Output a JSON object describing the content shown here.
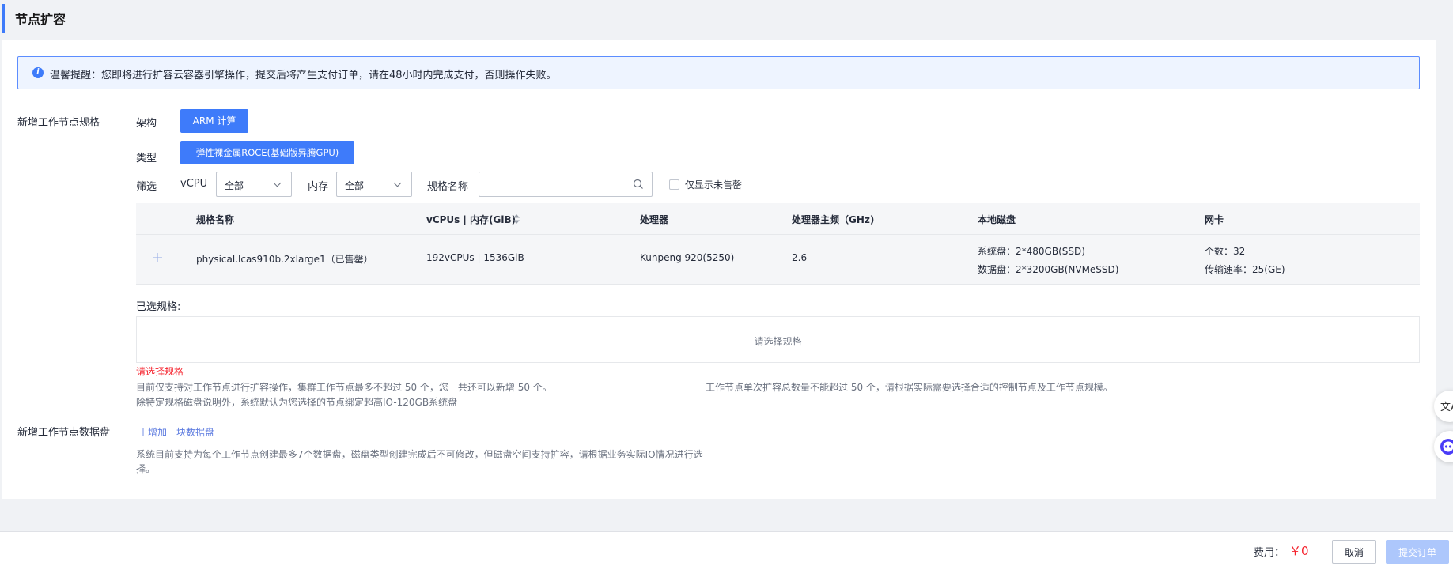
{
  "page": {
    "title": "节点扩容"
  },
  "notice": {
    "text": "温馨提醒：您即将进行扩容云容器引擎操作，提交后将产生支付订单，请在48小时内完成支付，否则操作失败。"
  },
  "spec": {
    "section_label": "新增工作节点规格",
    "arch_label": "架构",
    "arch_value": "ARM 计算",
    "type_label": "类型",
    "type_value": "弹性裸金属ROCE(基础版昇腾GPU)",
    "filter_label": "筛选",
    "vcpu_label": "vCPU",
    "vcpu_value": "全部",
    "memory_label": "内存",
    "memory_value": "全部",
    "name_label": "规格名称",
    "name_placeholder": "",
    "only_soldout_label": "仅显示未售罄"
  },
  "table": {
    "headers": [
      "规格名称",
      "vCPUs | 内存(GiB)",
      "处理器",
      "处理器主频（GHz)",
      "本地磁盘",
      "网卡"
    ],
    "rows": [
      {
        "name": "physical.lcas910b.2xlarge1（已售罄）",
        "vcpu_mem": "192vCPUs | 1536GiB",
        "processor": "Kunpeng 920(5250)",
        "freq": "2.6",
        "disk_system": "系统盘：2*480GB(SSD)",
        "disk_data": "数据盘：2*3200GB(NVMeSSD)",
        "nic_count": "个数：32",
        "nic_speed": "传输速率：25(GE)"
      }
    ]
  },
  "selected": {
    "label": "已选规格:",
    "placeholder": "请选择规格",
    "error": "请选择规格",
    "hint_left": "目前仅支持对工作节点进行扩容操作，集群工作节点最多不超过 50 个，您一共还可以新增 50 个。",
    "hint_right": "工作节点单次扩容总数量不能超过 50 个，请根据实际需要选择合适的控制节点及工作节点规模。",
    "hint_disk": "除特定规格磁盘说明外，系统默认为您选择的节点绑定超高IO-120GB系统盘"
  },
  "datadisk": {
    "section_label": "新增工作节点数据盘",
    "add_link": "增加一块数据盘",
    "hint_line1": "系统目前支持为每个工作节点创建最多7个数据盘，磁盘类型创建完成后不可修改，但磁盘空间支持扩容，请根据业务实际IO情况进行选",
    "hint_line2": "择。"
  },
  "footer": {
    "fee_label": "费用：",
    "fee_value": "￥0",
    "cancel_label": "取消",
    "submit_label": "提交订单"
  },
  "colors": {
    "primary": "#3e7bfa",
    "error": "#f5222d",
    "fee": "#f5222d"
  }
}
